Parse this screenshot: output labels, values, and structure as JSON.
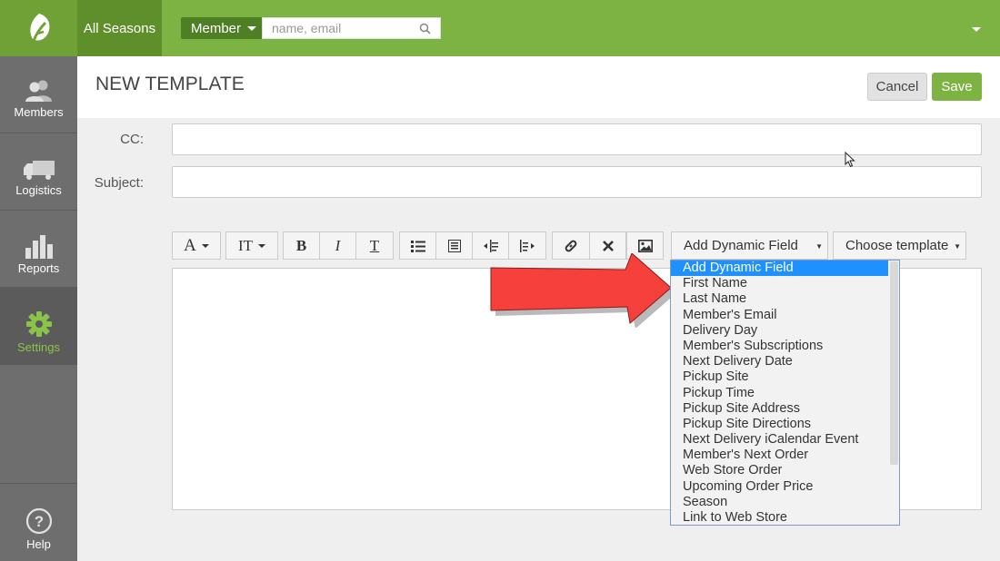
{
  "topbar": {
    "season_label": "All Seasons",
    "search_type": "Member",
    "search_placeholder": "name, email",
    "bg_color": "#7cb342"
  },
  "sidebar": {
    "items": [
      {
        "label": "Members",
        "icon": "members-icon"
      },
      {
        "label": "Logistics",
        "icon": "truck-icon"
      },
      {
        "label": "Reports",
        "icon": "bar-chart-icon"
      },
      {
        "label": "Settings",
        "icon": "gear-icon",
        "active": true
      }
    ],
    "help_label": "Help"
  },
  "header": {
    "title": "NEW TEMPLATE",
    "cancel_label": "Cancel",
    "save_label": "Save"
  },
  "form": {
    "cc_label": "CC:",
    "subject_label": "Subject:"
  },
  "toolbar": {
    "font_label": "A",
    "size_label": "IT",
    "bold_label": "B",
    "italic_label": "I",
    "strike_label": "T",
    "dynamic_field_label": "Add Dynamic Field",
    "choose_template_label": "Choose template"
  },
  "dynamic_fields": {
    "options": [
      "Add Dynamic Field",
      "First Name",
      "Last Name",
      "Member's Email",
      "Delivery Day",
      "Member's Subscriptions",
      "Next Delivery Date",
      "Pickup Site",
      "Pickup Time",
      "Pickup Site Address",
      "Pickup Site Directions",
      "Next Delivery iCalendar Event",
      "Member's Next Order",
      "Web Store Order",
      "Upcoming Order Price",
      "Season",
      "Link to Web Store"
    ],
    "selected_index": 0,
    "highlight_color": "#1e90ff"
  },
  "annotation": {
    "arrow_color": "#f44336"
  }
}
